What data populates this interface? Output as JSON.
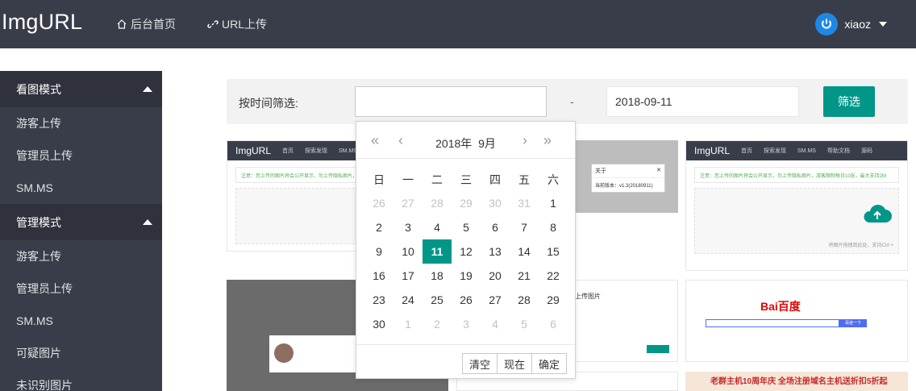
{
  "header": {
    "logo": "ImgURL",
    "nav": [
      {
        "label": "后台首页",
        "icon": "home-icon"
      },
      {
        "label": "URL上传",
        "icon": "link-icon"
      }
    ],
    "user": {
      "name": "xiaoz",
      "avatar_icon": "power-icon"
    }
  },
  "sidebar": {
    "groups": [
      {
        "label": "看图模式",
        "items": [
          "游客上传",
          "管理员上传",
          "SM.MS"
        ]
      },
      {
        "label": "管理模式",
        "items": [
          "游客上传",
          "管理员上传",
          "SM.MS",
          "可疑图片",
          "未识别图片"
        ]
      }
    ]
  },
  "filter": {
    "label": "按时间筛选:",
    "start_value": "",
    "separator": "-",
    "end_value": "2018-09-11",
    "button": "筛选"
  },
  "datepicker": {
    "year": "2018年",
    "month": "9月",
    "weekdays": [
      "日",
      "一",
      "二",
      "三",
      "四",
      "五",
      "六"
    ],
    "rows": [
      [
        "26",
        "27",
        "28",
        "29",
        "30",
        "31",
        "1"
      ],
      [
        "2",
        "3",
        "4",
        "5",
        "6",
        "7",
        "8"
      ],
      [
        "9",
        "10",
        "11",
        "12",
        "13",
        "14",
        "15"
      ],
      [
        "16",
        "17",
        "18",
        "19",
        "20",
        "21",
        "22"
      ],
      [
        "23",
        "24",
        "25",
        "26",
        "27",
        "28",
        "29"
      ],
      [
        "30",
        "1",
        "2",
        "3",
        "4",
        "5",
        "6"
      ]
    ],
    "selected": "11",
    "buttons": [
      "清空",
      "现在",
      "确定"
    ]
  },
  "thumbs": {
    "card1": {
      "logo": "ImgURL",
      "nav": [
        "首页",
        "探索发现",
        "SM.MS"
      ],
      "note": "注意：您上传的图片将会公开显示，勿上传隐私图片，游客限制每日上传"
    },
    "card2": {
      "dialog_title": "关于",
      "dialog_text": "当前版本：v1.3(20180911)"
    },
    "card3": {
      "logo": "ImgURL",
      "nav": [
        "首页",
        "探索发现",
        "SM.MS",
        "帮助文档",
        "源码"
      ],
      "note": "注意：您上传的图片将会公开显示，勿上传隐私图片，游客限制每日10张，最大支持2M",
      "hint": "将图片拖拽到此处，支持Ctrl +"
    },
    "card5": {
      "title": "上传图片"
    },
    "card6": {
      "logo": "Bai百度",
      "search_btn": "百度一下"
    },
    "card7": {
      "banner": "老群主机10周年庆 全场注册域名主机送折扣5折起"
    }
  },
  "colors": {
    "header": "#393d49",
    "accent": "#009688",
    "sidebar_group": "#2f323c"
  }
}
